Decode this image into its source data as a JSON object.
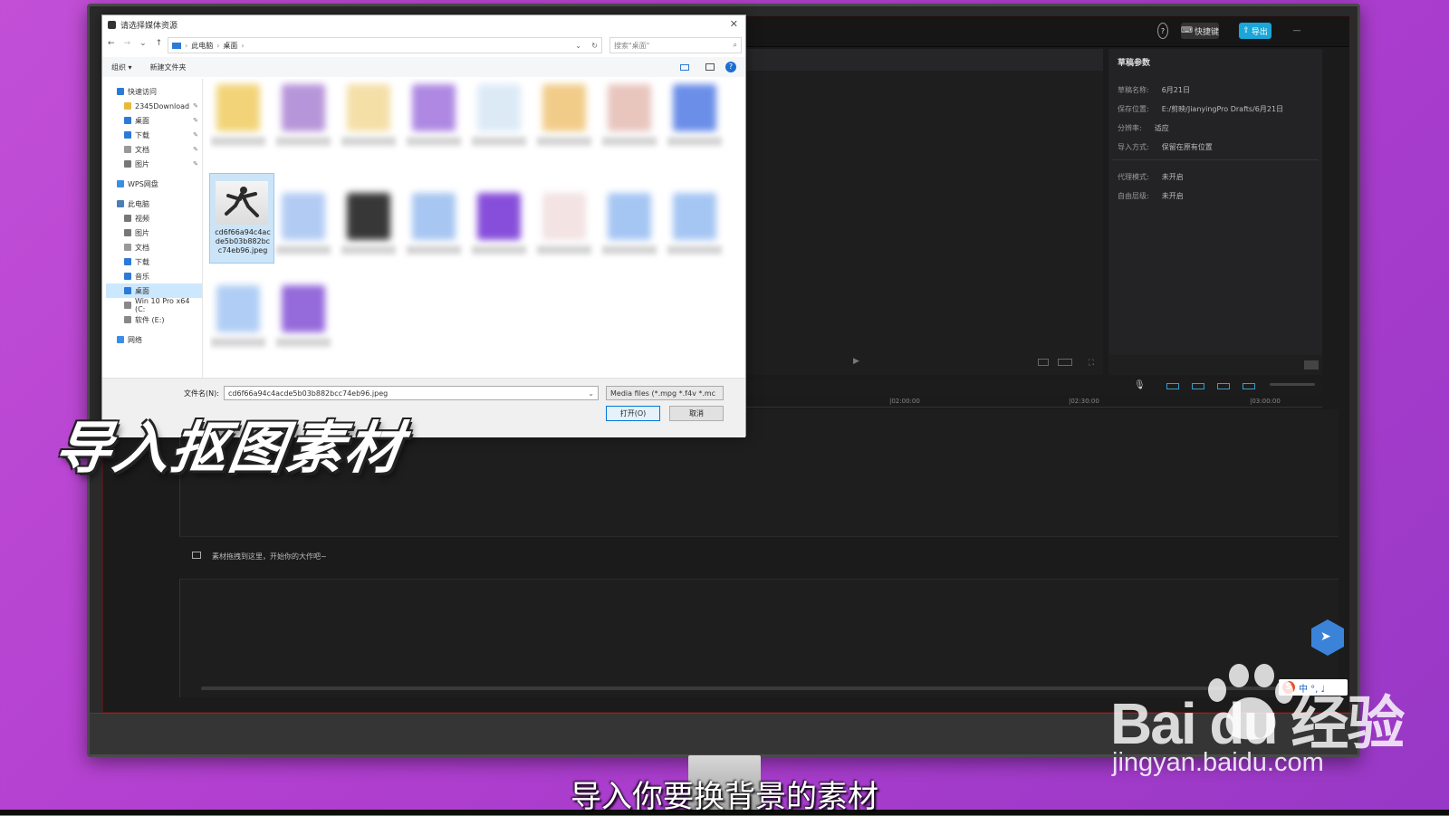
{
  "dialog": {
    "title": "请选择媒体资源",
    "breadcrumb": [
      "此电脑",
      "桌面"
    ],
    "search_placeholder": "搜索\"桌面\"",
    "toolbar": {
      "organize": "组织 ▾",
      "new_folder": "新建文件夹"
    },
    "nav": [
      {
        "label": "快速访问",
        "icon": "star-icon",
        "pinned": false
      },
      {
        "label": "2345Download",
        "icon": "folder-icon",
        "pinned": true
      },
      {
        "label": "桌面",
        "icon": "desktop-icon",
        "pinned": true
      },
      {
        "label": "下载",
        "icon": "download-icon",
        "pinned": true
      },
      {
        "label": "文档",
        "icon": "document-icon",
        "pinned": true
      },
      {
        "label": "图片",
        "icon": "picture-icon",
        "pinned": true
      },
      {
        "label": "WPS网盘",
        "icon": "cloud-icon",
        "pinned": false
      },
      {
        "label": "此电脑",
        "icon": "computer-icon",
        "pinned": false
      },
      {
        "label": "视频",
        "icon": "video-icon",
        "pinned": false
      },
      {
        "label": "图片",
        "icon": "picture-icon",
        "pinned": false
      },
      {
        "label": "文档",
        "icon": "document-icon",
        "pinned": false
      },
      {
        "label": "下载",
        "icon": "download-icon",
        "pinned": false
      },
      {
        "label": "音乐",
        "icon": "music-icon",
        "pinned": false
      },
      {
        "label": "桌面",
        "icon": "desktop-icon",
        "pinned": false
      },
      {
        "label": "Win 10 Pro x64 (C:",
        "icon": "drive-icon",
        "pinned": false
      },
      {
        "label": "软件 (E:)",
        "icon": "drive-icon",
        "pinned": false
      },
      {
        "label": "网络",
        "icon": "network-icon",
        "pinned": false
      }
    ],
    "selected_file": {
      "name_lines": [
        "cd6f66a94c4ac",
        "de5b03b882bc",
        "c74eb96.jpeg"
      ]
    },
    "filename_label": "文件名(N):",
    "filename_value": "cd6f66a94c4acde5b03b882bcc74eb96.jpeg",
    "filetype_value": "Media files (*.mpg *.f4v *.mc",
    "open_button": "打开(O)",
    "cancel_button": "取消"
  },
  "app": {
    "topbar": {
      "shortcut_label": "快捷键",
      "export_label": "导出"
    },
    "draft": {
      "title": "草稿参数",
      "rows": [
        {
          "label": "草稿名称:",
          "value": "6月21日"
        },
        {
          "label": "保存位置:",
          "value": "E:/剪映/JianyingPro Drafts/6月21日"
        },
        {
          "label": "分辨率:",
          "value": "适应"
        },
        {
          "label": "导入方式:",
          "value": "保留在原有位置"
        }
      ],
      "rows2": [
        {
          "label": "代理模式:",
          "value": "未开启"
        },
        {
          "label": "自由层级:",
          "value": "未开启"
        }
      ]
    },
    "timeline": {
      "ruler": [
        "|02:00:00",
        "|02:30:00",
        "|03:00:00"
      ],
      "hint": "素材拖拽到这里，开始你的大作吧~"
    }
  },
  "overlay": {
    "caption": "导入抠图素材",
    "subtitle": "导入你要换背景的素材",
    "watermark_logo": "Bai du 经验",
    "watermark_url": "jingyan.baidu.com",
    "ime": "中 °, ♩"
  },
  "colors": {
    "export_accent": "#1aa6d8",
    "background": "#b444d2"
  }
}
